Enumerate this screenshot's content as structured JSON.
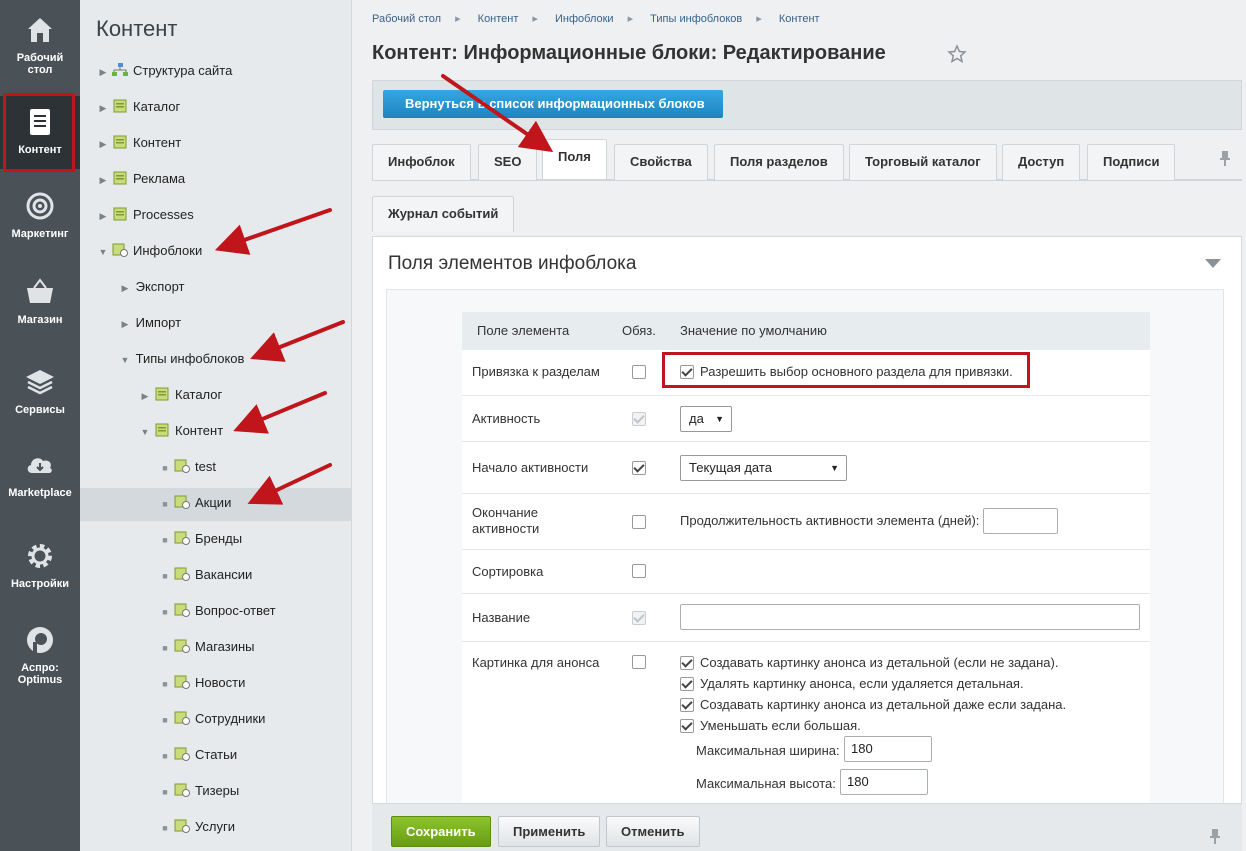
{
  "rail": {
    "items": [
      {
        "label1": "Рабочий",
        "label2": "стол",
        "icon": "home-icon"
      },
      {
        "label1": "Контент",
        "label2": "",
        "icon": "document-icon"
      },
      {
        "label1": "Маркетинг",
        "label2": "",
        "icon": "target-icon"
      },
      {
        "label1": "Магазин",
        "label2": "",
        "icon": "basket-icon"
      },
      {
        "label1": "Сервисы",
        "label2": "",
        "icon": "layers-icon"
      },
      {
        "label1": "Marketplace",
        "label2": "",
        "icon": "cloud-download-icon"
      },
      {
        "label1": "Настройки",
        "label2": "",
        "icon": "gear-icon"
      },
      {
        "label1": "Аспро:",
        "label2": "Optimus",
        "icon": "aspro-logo-icon"
      }
    ],
    "bg_color": "#4a5258",
    "highlight_color": "#c0151b"
  },
  "tree": {
    "title": "Контент",
    "items": [
      {
        "label": "Структура сайта"
      },
      {
        "label": "Каталог"
      },
      {
        "label": "Контент"
      },
      {
        "label": "Реклама"
      },
      {
        "label": "Processes"
      },
      {
        "label": "Инфоблоки"
      },
      {
        "label": "Экспорт"
      },
      {
        "label": "Импорт"
      },
      {
        "label": "Типы инфоблоков"
      },
      {
        "label": "Каталог"
      },
      {
        "label": "Контент"
      },
      {
        "label": "test"
      },
      {
        "label": "Акции"
      },
      {
        "label": "Бренды"
      },
      {
        "label": "Вакансии"
      },
      {
        "label": "Вопрос-ответ"
      },
      {
        "label": "Магазины"
      },
      {
        "label": "Новости"
      },
      {
        "label": "Сотрудники"
      },
      {
        "label": "Статьи"
      },
      {
        "label": "Тизеры"
      },
      {
        "label": "Услуги"
      }
    ]
  },
  "breadcrumb": [
    "Рабочий стол",
    "Контент",
    "Инфоблоки",
    "Типы инфоблоков",
    "Контент"
  ],
  "page_title": "Контент: Информационные блоки: Редактирование",
  "back_button": "Вернуться в список информационных блоков",
  "tabs": [
    "Инфоблок",
    "SEO",
    "Поля",
    "Свойства",
    "Поля разделов",
    "Торговый каталог",
    "Доступ",
    "Подписи",
    "Журнал событий"
  ],
  "active_tab": "Поля",
  "section_title": "Поля элементов инфоблока",
  "table": {
    "headers": [
      "Поле элемента",
      "Обяз.",
      "Значение по умолчанию"
    ],
    "rows": {
      "binding": {
        "label": "Привязка к разделам",
        "option": "Разрешить выбор основного раздела для привязки."
      },
      "active": {
        "label": "Активность",
        "select": "да"
      },
      "active_from": {
        "label": "Начало активности",
        "select": "Текущая дата"
      },
      "active_to": {
        "label1": "Окончание",
        "label2": "активности",
        "text": "Продолжительность активности элемента (дней):"
      },
      "sort": {
        "label": "Сортировка"
      },
      "name": {
        "label": "Название"
      },
      "preview": {
        "label": "Картинка для анонса",
        "options": [
          "Создавать картинку анонса из детальной (если не задана).",
          "Удалять картинку анонса, если удаляется детальная.",
          "Создавать картинку анонса из детальной даже если задана.",
          "Уменьшать если большая."
        ],
        "max_width_label": "Максимальная ширина:",
        "max_width": "180",
        "max_height_label": "Максимальная высота:",
        "max_height": "180"
      }
    }
  },
  "footer": {
    "save": "Сохранить",
    "apply": "Применить",
    "cancel": "Отменить"
  },
  "colors": {
    "accent_blue": "#1d84c2",
    "save_green": "#679c12",
    "annotation_red": "#c0151b"
  }
}
